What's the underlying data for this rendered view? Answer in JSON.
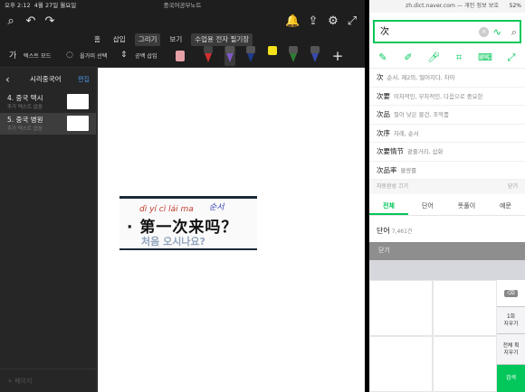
{
  "left_app": {
    "status": {
      "time": "오후 2:12",
      "date": "4월 27일 월요일"
    },
    "document_title": "중국어공부노트",
    "menu_tabs": [
      {
        "label": "홈",
        "active": false
      },
      {
        "label": "삽입",
        "active": false
      },
      {
        "label": "그리기",
        "active": true
      },
      {
        "label": "보기",
        "active": false
      },
      {
        "label": "수업용 전자 필기장",
        "active": false
      }
    ],
    "tools": {
      "text_mode": "텍스트 모드",
      "lasso_select": "올가미 선택",
      "insert_space": "공백 삽입"
    },
    "sidebar": {
      "title": "시리중국어",
      "edit": "편집",
      "pages": [
        {
          "title": "4. 중국 택시",
          "subtitle": "추가 텍스트 없음",
          "selected": false
        },
        {
          "title": "5. 중국 병원",
          "subtitle": "추가 텍스트 없음",
          "selected": true
        }
      ],
      "footer": "+ 페이지"
    },
    "canvas": {
      "pinyin": "dì yí cì lái ma",
      "hanzi": "· 第一次来吗？",
      "hangul": "처음 오시나요?",
      "handwriting": "순서"
    }
  },
  "right_app": {
    "status": {
      "url": "zh.dict.naver.com — 개인 정보 보호",
      "battery": "52%"
    },
    "search": {
      "value": "次"
    },
    "suggestions": [
      {
        "kw": "次",
        "desc": "순서, 제2의, 떨어지다, 차아"
      },
      {
        "kw": "次要",
        "desc": "이차적인, 부차적인, 다음으로 중요한"
      },
      {
        "kw": "次品",
        "desc": "질이 낮은 물건, 조악품"
      },
      {
        "kw": "次序",
        "desc": "차례, 순서"
      },
      {
        "kw": "次要情节",
        "desc": "곁줄거리, 삽화"
      },
      {
        "kw": "次品率",
        "desc": "불량률"
      }
    ],
    "autocomplete": {
      "label": "자동완성 끄기",
      "close": "닫기"
    },
    "result_tabs": [
      {
        "label": "전체",
        "active": true
      },
      {
        "label": "단어",
        "active": false
      },
      {
        "label": "뜻풀이",
        "active": false
      },
      {
        "label": "예문",
        "active": false
      }
    ],
    "word_count": {
      "label": "단어",
      "count": "7,461건"
    },
    "close_bar": "닫기",
    "keyboard": {
      "undo": "1회\n지우기",
      "clear_all": "전체 획\n지우기",
      "search": "검색"
    }
  }
}
